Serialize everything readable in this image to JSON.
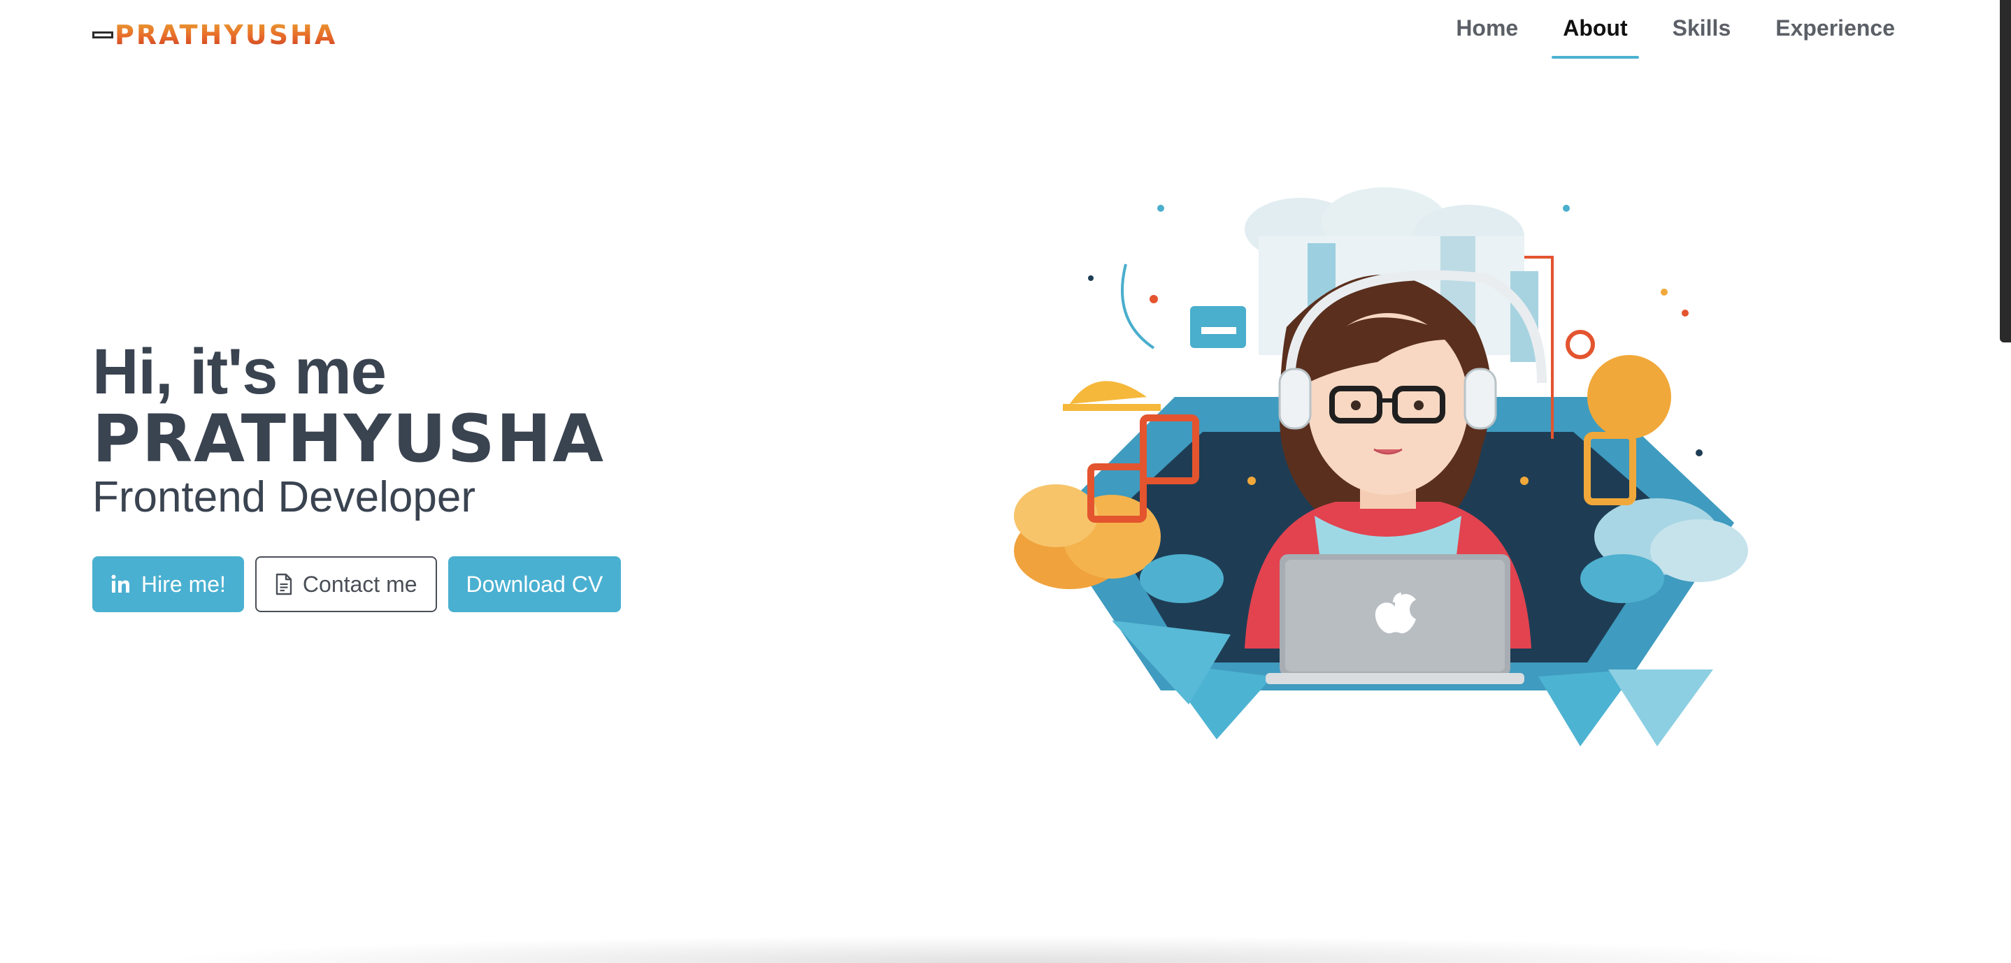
{
  "header": {
    "logo_text": "PRATHYUSHA",
    "nav": [
      {
        "label": "Home",
        "active": false
      },
      {
        "label": "About",
        "active": true
      },
      {
        "label": "Skills",
        "active": false
      },
      {
        "label": "Experience",
        "active": false
      }
    ]
  },
  "hero": {
    "greeting": "Hi, it's me",
    "name": "PRATHYUSHA",
    "role": "Frontend Developer",
    "buttons": {
      "hire": "Hire me!",
      "contact": "Contact me",
      "download": "Download CV"
    }
  },
  "icons": {
    "hire": "linkedin-icon",
    "contact": "document-icon"
  },
  "colors": {
    "accent": "#4ab0d1",
    "text": "#3a4350",
    "logo": "#e1572b"
  }
}
